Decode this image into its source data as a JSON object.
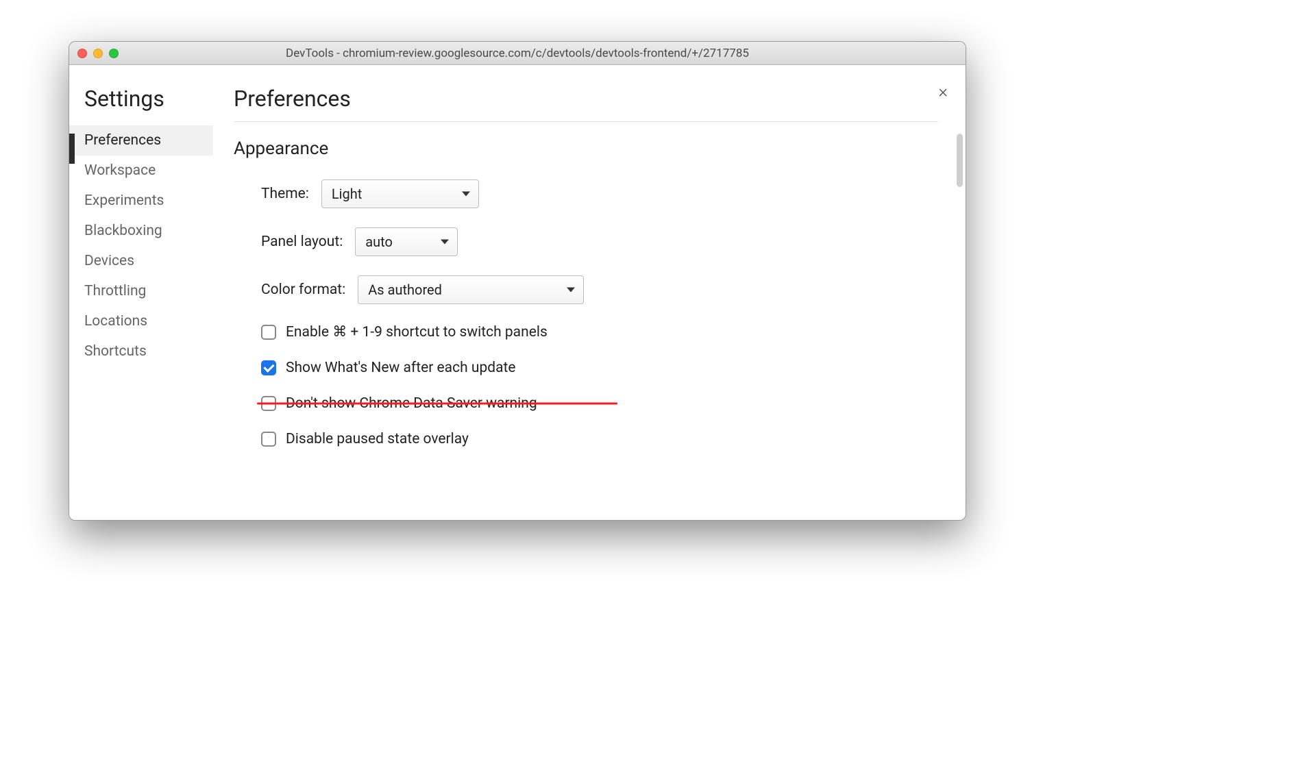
{
  "window": {
    "title": "DevTools - chromium-review.googlesource.com/c/devtools/devtools-frontend/+/2717785"
  },
  "sidebar": {
    "title": "Settings",
    "items": [
      {
        "label": "Preferences",
        "active": true
      },
      {
        "label": "Workspace",
        "active": false
      },
      {
        "label": "Experiments",
        "active": false
      },
      {
        "label": "Blackboxing",
        "active": false
      },
      {
        "label": "Devices",
        "active": false
      },
      {
        "label": "Throttling",
        "active": false
      },
      {
        "label": "Locations",
        "active": false
      },
      {
        "label": "Shortcuts",
        "active": false
      }
    ]
  },
  "main": {
    "title": "Preferences",
    "section": "Appearance",
    "fields": {
      "theme_label": "Theme:",
      "theme_value": "Light",
      "panel_layout_label": "Panel layout:",
      "panel_layout_value": "auto",
      "color_format_label": "Color format:",
      "color_format_value": "As authored"
    },
    "checks": {
      "shortcut": {
        "label": "Enable ⌘ + 1-9 shortcut to switch panels",
        "checked": false
      },
      "whatsnew": {
        "label": "Show What's New after each update",
        "checked": true
      },
      "datasaver": {
        "label": "Don't show Chrome Data Saver warning",
        "checked": false,
        "struck": true
      },
      "paused": {
        "label": "Disable paused state overlay",
        "checked": false
      }
    }
  },
  "close_label": "×"
}
